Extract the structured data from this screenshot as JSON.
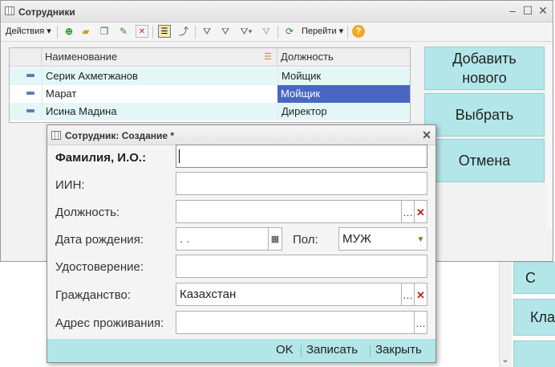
{
  "main_window": {
    "title": "Сотрудники",
    "toolbar": {
      "actions_label": "Действия",
      "goto_label": "Перейти"
    },
    "grid": {
      "headers": [
        "Наименование",
        "Должность"
      ],
      "rows": [
        {
          "name": "Серик Ахметжанов",
          "position": "Мойщик"
        },
        {
          "name": "Марат",
          "position": "Мойщик"
        },
        {
          "name": "Исина Мадина",
          "position": "Директор"
        }
      ]
    },
    "buttons": {
      "add": "Добавить нового",
      "select": "Выбрать",
      "cancel": "Отмена"
    }
  },
  "background_buttons": {
    "partial1": "С",
    "partial2": "Кла"
  },
  "dialog": {
    "title": "Сотрудник: Создание *",
    "fields": {
      "fio_label": "Фамилия, И.О.:",
      "fio_value": "",
      "iin_label": "ИИН:",
      "iin_value": "",
      "position_label": "Должность:",
      "position_value": "",
      "birth_label": "Дата рождения:",
      "birth_value": " .  .",
      "gender_label": "Пол:",
      "gender_value": "МУЖ",
      "id_label": "Удостоверение:",
      "id_value": "",
      "citizenship_label": "Гражданство:",
      "citizenship_value": "Казахстан",
      "address_label": "Адрес проживания:",
      "address_value": ""
    },
    "footer": {
      "ok": "OK",
      "save": "Записать",
      "close": "Закрыть"
    }
  },
  "colors": {
    "accent": "#b3e6e8",
    "row_even": "#e6f8f8",
    "selected_cell": "#4a66c4"
  }
}
